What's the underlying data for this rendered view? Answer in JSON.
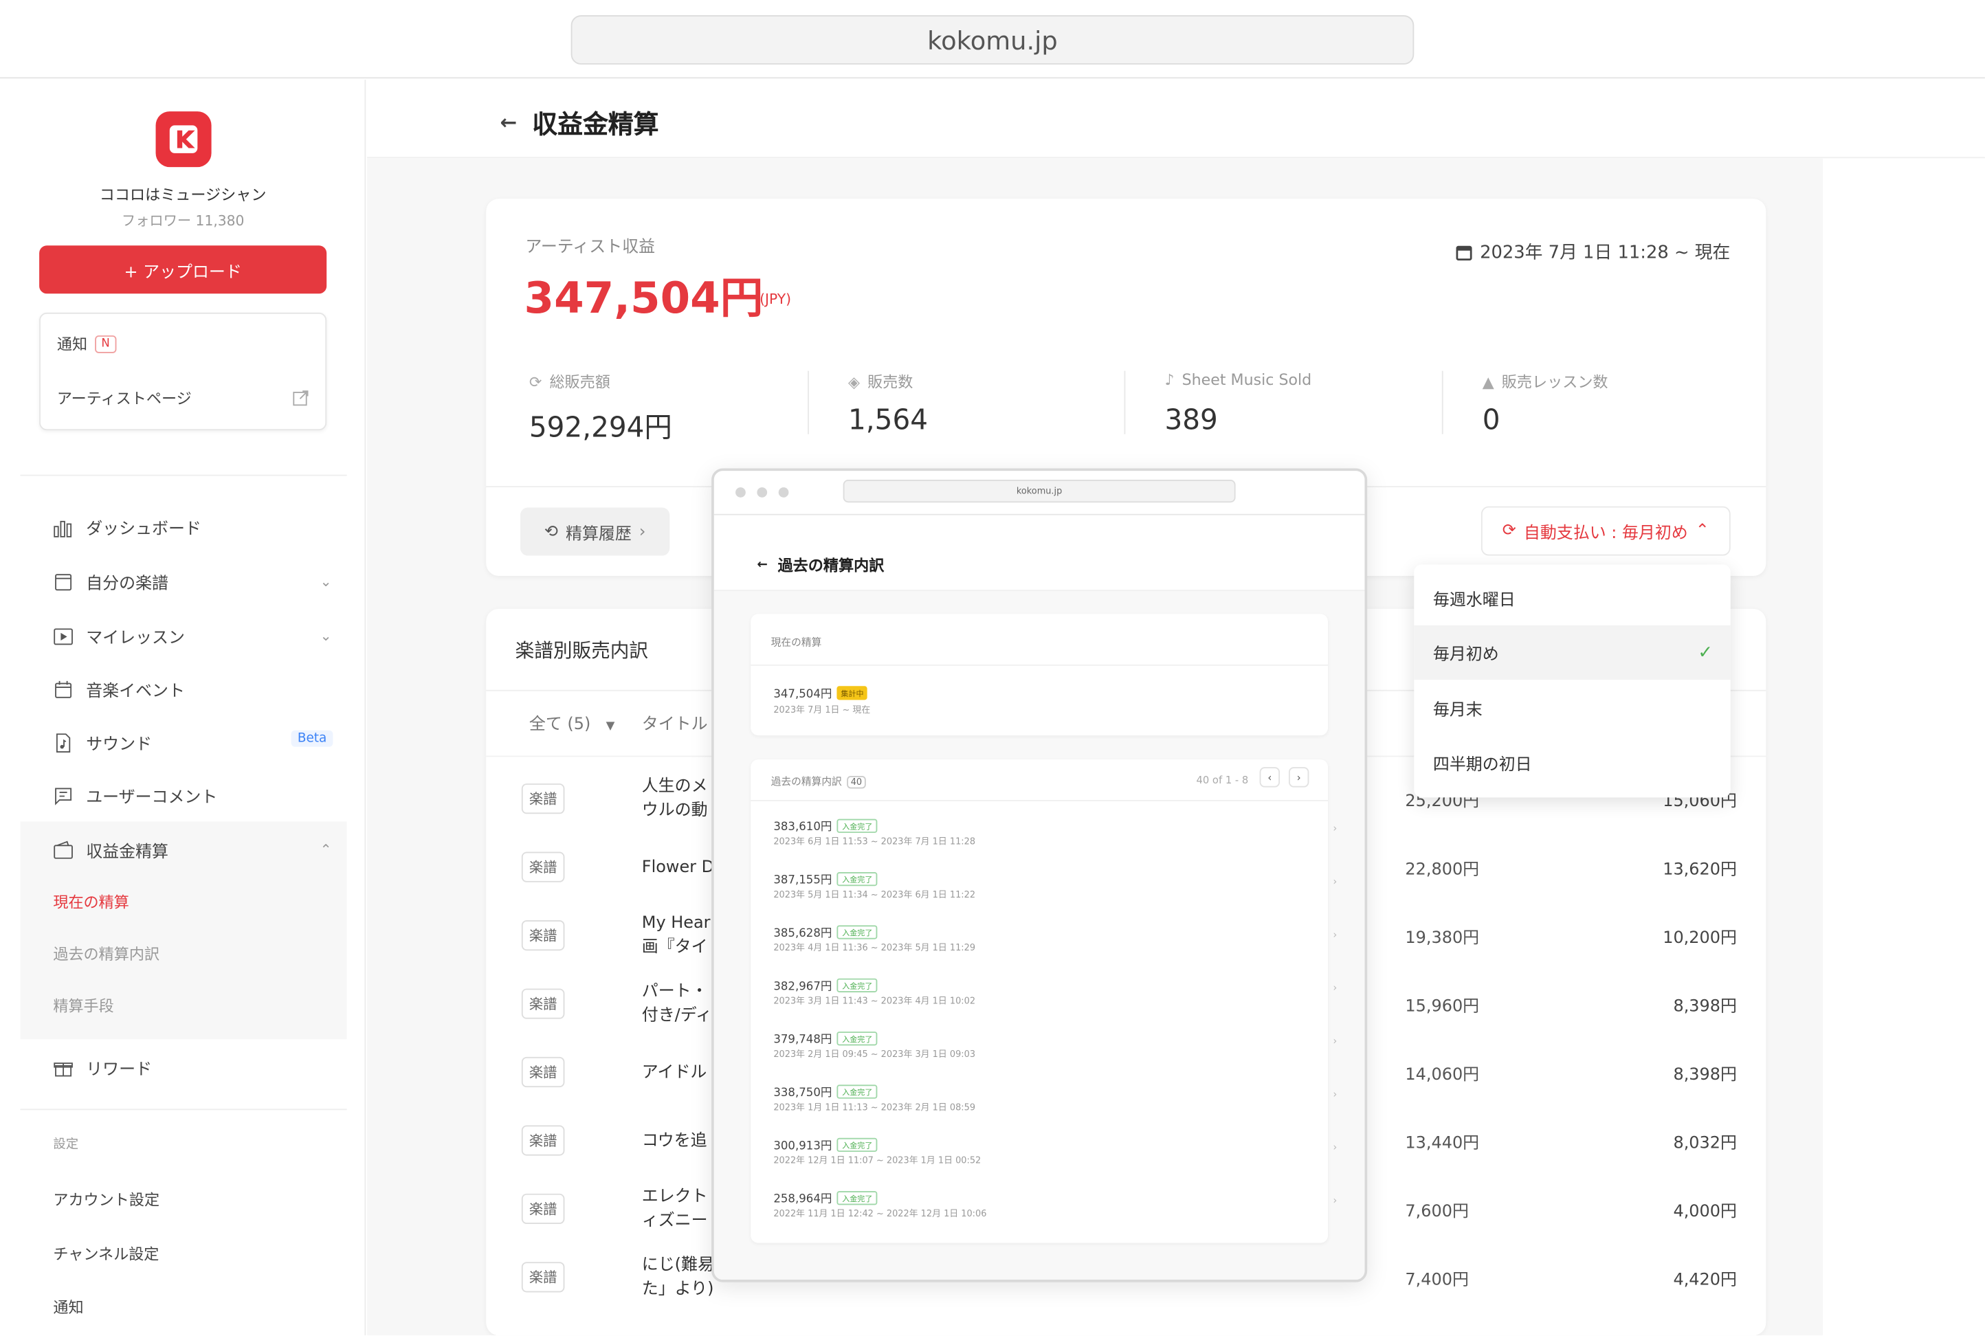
{
  "browser": {
    "url": "kokomu.jp"
  },
  "profile": {
    "name": "ココロはミュージシャン",
    "followers": "フォロワー 11,380"
  },
  "upload_label": "+ アップロード",
  "quick": {
    "notify": "通知",
    "notify_badge": "N",
    "artist_page": "アーティストページ"
  },
  "nav": {
    "dashboard": "ダッシュボード",
    "my_scores": "自分の楽譜",
    "my_lessons": "マイレッスン",
    "events": "音楽イベント",
    "sound": "サウンド",
    "sound_badge": "Beta",
    "comments": "ユーザーコメント",
    "settlement": "収益金精算",
    "sub_current": "現在の精算",
    "sub_past": "過去の精算内訳",
    "sub_method": "精算手段",
    "reward": "リワード"
  },
  "settings": {
    "label": "設定",
    "account": "アカウント設定",
    "channel": "チャンネル設定",
    "notify": "通知"
  },
  "page": {
    "title": "収益金精算"
  },
  "earnings": {
    "label": "アーティスト収益",
    "amount": "347,504円",
    "currency": "(JPY)",
    "date_range": "2023年 7月 1日 11:28 ~ 現在",
    "stats": [
      {
        "label": "総販売額",
        "value": "592,294円"
      },
      {
        "label": "販売数",
        "value": "1,564"
      },
      {
        "label": "Sheet Music Sold",
        "value": "389"
      },
      {
        "label": "販売レッスン数",
        "value": "0"
      }
    ],
    "history_btn": "精算履歴",
    "auto_pay": "自動支払い : 毎月初め"
  },
  "dropdown": {
    "options": [
      "毎週水曜日",
      "毎月初め",
      "毎月末",
      "四半期の初日"
    ],
    "selected": "毎月初め"
  },
  "table": {
    "title": "楽譜別販売内訳",
    "filter": "全て (5)",
    "col_title": "タイトル",
    "rows": [
      {
        "tag": "楽譜",
        "title": "人生のメ\nウルの動",
        "v1": "25,200円",
        "v2": "15,060円"
      },
      {
        "tag": "楽譜",
        "title": "Flower D",
        "v1": "22,800円",
        "v2": "13,620円"
      },
      {
        "tag": "楽譜",
        "title": "My Hear\n画『タイ",
        "v1": "19,380円",
        "v2": "10,200円"
      },
      {
        "tag": "楽譜",
        "title": "パート・\n付き/ディ",
        "v1": "15,960円",
        "v2": "8,398円"
      },
      {
        "tag": "楽譜",
        "title": "アイドル",
        "v1": "14,060円",
        "v2": "8,398円"
      },
      {
        "tag": "楽譜",
        "title": "コウを追",
        "v1": "13,440円",
        "v2": "8,032円"
      },
      {
        "tag": "楽譜",
        "title": "エレクト\nィズニー",
        "v1": "7,600円",
        "v2": "4,000円"
      },
      {
        "tag": "楽譜",
        "title": "にじ(難易\nた」より)",
        "v1": "7,400円",
        "v2": "4,420円"
      }
    ]
  },
  "popup": {
    "url": "kokomu.jp",
    "title": "過去の精算内訳",
    "current_label": "現在の精算",
    "current_amount": "347,504円",
    "current_badge": "集計中",
    "current_date": "2023年 7月 1日 ~ 現在",
    "past_label": "過去の精算内訳",
    "past_count": "40",
    "pager": "40 of 1 - 8",
    "items": [
      {
        "amount": "383,610円",
        "badge": "入金完了",
        "range": "2023年 6月 1日 11:53 ~ 2023年 7月 1日 11:28"
      },
      {
        "amount": "387,155円",
        "badge": "入金完了",
        "range": "2023年 5月 1日 11:34 ~ 2023年 6月 1日 11:22"
      },
      {
        "amount": "385,628円",
        "badge": "入金完了",
        "range": "2023年 4月 1日 11:36 ~ 2023年 5月 1日 11:29"
      },
      {
        "amount": "382,967円",
        "badge": "入金完了",
        "range": "2023年 3月 1日 11:43 ~ 2023年 4月 1日 10:02"
      },
      {
        "amount": "379,748円",
        "badge": "入金完了",
        "range": "2023年 2月 1日 09:45 ~ 2023年 3月 1日 09:03"
      },
      {
        "amount": "338,750円",
        "badge": "入金完了",
        "range": "2023年 1月 1日 11:13 ~ 2023年 2月 1日 08:59"
      },
      {
        "amount": "300,913円",
        "badge": "入金完了",
        "range": "2022年 12月 1日 11:07 ~ 2023年 1月 1日 00:52"
      },
      {
        "amount": "258,964円",
        "badge": "入金完了",
        "range": "2022年 11月 1日 12:42 ~ 2022年 12月 1日 10:06"
      }
    ]
  },
  "colors": {
    "accent": "#e5393f",
    "success": "#4caf50",
    "badge_yellow": "#f5c518"
  }
}
